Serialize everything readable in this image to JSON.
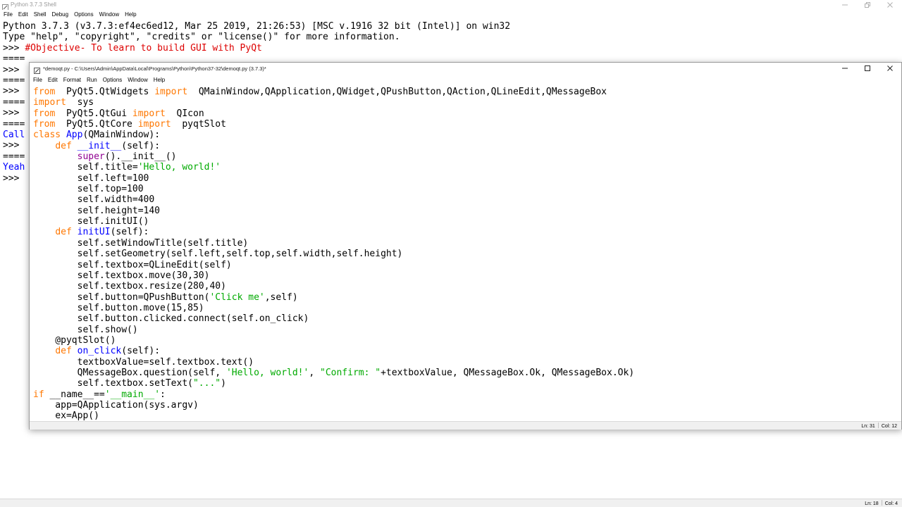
{
  "shell": {
    "title": "Python 3.7.3 Shell",
    "menu": [
      "File",
      "Edit",
      "Shell",
      "Debug",
      "Options",
      "Window",
      "Help"
    ],
    "banner_line1": "Python 3.7.3 (v3.7.3:ef4ec6ed12, Mar 25 2019, 21:26:53) [MSC v.1916 32 bit (Intel)] on win32",
    "banner_line2": "Type \"help\", \"copyright\", \"credits\" or \"license()\" for more information.",
    "prompt": ">>> ",
    "comment_line": "#Objective- To learn to build GUI with PyQt",
    "partial_lines": [
      "====",
      ">>> ",
      "====",
      ">>> ",
      "====",
      ">>> ",
      "====",
      "Call",
      ">>> ",
      "====",
      "Yeah",
      ">>> "
    ],
    "status": {
      "ln": "Ln: 18",
      "col": "Col: 4"
    }
  },
  "editor": {
    "title": "*demoqt.py - C:\\Users\\Admin\\AppData\\Local\\Programs\\Python\\Python37-32\\demoqt.py (3.7.3)*",
    "menu": [
      "File",
      "Edit",
      "Format",
      "Run",
      "Options",
      "Window",
      "Help"
    ],
    "status": {
      "ln": "Ln: 31",
      "col": "Col: 12"
    }
  },
  "code_lines": [
    [
      [
        "kw",
        "from"
      ],
      [
        "",
        "  PyQt5.QtWidgets "
      ],
      [
        "kw",
        "import"
      ],
      [
        "",
        "  QMainWindow,QApplication,QWidget,QPushButton,QAction,QLineEdit,QMessageBox"
      ]
    ],
    [
      [
        "kw",
        "import"
      ],
      [
        "",
        "  sys"
      ]
    ],
    [
      [
        "kw",
        "from"
      ],
      [
        "",
        "  PyQt5.QtGui "
      ],
      [
        "kw",
        "import"
      ],
      [
        "",
        "  QIcon"
      ]
    ],
    [
      [
        "kw",
        "from"
      ],
      [
        "",
        "  PyQt5.QtCore "
      ],
      [
        "kw",
        "import"
      ],
      [
        "",
        "  pyqtSlot"
      ]
    ],
    [
      [
        "kw",
        "class"
      ],
      [
        "",
        " "
      ],
      [
        "def",
        "App"
      ],
      [
        "",
        "(QMainWindow):"
      ]
    ],
    [
      [
        "",
        "    "
      ],
      [
        "kw",
        "def"
      ],
      [
        "",
        " "
      ],
      [
        "def",
        "__init__"
      ],
      [
        "",
        "(self):"
      ]
    ],
    [
      [
        "",
        "        "
      ],
      [
        "bi",
        "super"
      ],
      [
        "",
        "().__init__()"
      ]
    ],
    [
      [
        "",
        "        self.title="
      ],
      [
        "str",
        "'Hello, world!'"
      ]
    ],
    [
      [
        "",
        "        self.left=100"
      ]
    ],
    [
      [
        "",
        "        self.top=100"
      ]
    ],
    [
      [
        "",
        "        self.width=400"
      ]
    ],
    [
      [
        "",
        "        self.height=140"
      ]
    ],
    [
      [
        "",
        "        self.initUI()"
      ]
    ],
    [
      [
        "",
        "    "
      ],
      [
        "kw",
        "def"
      ],
      [
        "",
        " "
      ],
      [
        "def",
        "initUI"
      ],
      [
        "",
        "(self):"
      ]
    ],
    [
      [
        "",
        "        self.setWindowTitle(self.title)"
      ]
    ],
    [
      [
        "",
        "        self.setGeometry(self.left,self.top,self.width,self.height)"
      ]
    ],
    [
      [
        "",
        "        self.textbox=QLineEdit(self)"
      ]
    ],
    [
      [
        "",
        "        self.textbox.move(30,30)"
      ]
    ],
    [
      [
        "",
        "        self.textbox.resize(280,40)"
      ]
    ],
    [
      [
        "",
        "        self.button=QPushButton("
      ],
      [
        "str",
        "'Click me'"
      ],
      [
        "",
        ",self)"
      ]
    ],
    [
      [
        "",
        "        self.button.move(15,85)"
      ]
    ],
    [
      [
        "",
        "        self.button.clicked.connect(self.on_click)"
      ]
    ],
    [
      [
        "",
        "        self.show()"
      ]
    ],
    [
      [
        "",
        "    @pyqtSlot()"
      ]
    ],
    [
      [
        "",
        "    "
      ],
      [
        "kw",
        "def"
      ],
      [
        "",
        " "
      ],
      [
        "def",
        "on_click"
      ],
      [
        "",
        "(self):"
      ]
    ],
    [
      [
        "",
        "        textboxValue=self.textbox.text()"
      ]
    ],
    [
      [
        "",
        "        QMessageBox.question(self, "
      ],
      [
        "str",
        "'Hello, world!'"
      ],
      [
        "",
        ", "
      ],
      [
        "str",
        "\"Confirm: \""
      ],
      [
        "",
        "+textboxValue, QMessageBox.Ok, QMessageBox.Ok)"
      ]
    ],
    [
      [
        "",
        "        self.textbox.setText("
      ],
      [
        "str",
        "\"...\""
      ],
      [
        "",
        ")"
      ]
    ],
    [
      [
        "kw",
        "if"
      ],
      [
        "",
        " __name__=="
      ],
      [
        "str",
        "'__main__'"
      ],
      [
        "",
        ":"
      ]
    ],
    [
      [
        "",
        "    app=QApplication(sys.argv)"
      ]
    ],
    [
      [
        "",
        "    ex=App()"
      ]
    ]
  ],
  "colors": {
    "keyword": "#ff7700",
    "string": "#00aa00",
    "builtin": "#900090",
    "definition": "#0000ff",
    "comment": "#dd0000",
    "status_bar": "#f0f0f0"
  },
  "icons": {
    "app_icon": "python-feather-icon",
    "minimize": "minimize-icon",
    "maximize": "maximize-icon",
    "restore": "restore-icon",
    "close": "close-icon"
  }
}
